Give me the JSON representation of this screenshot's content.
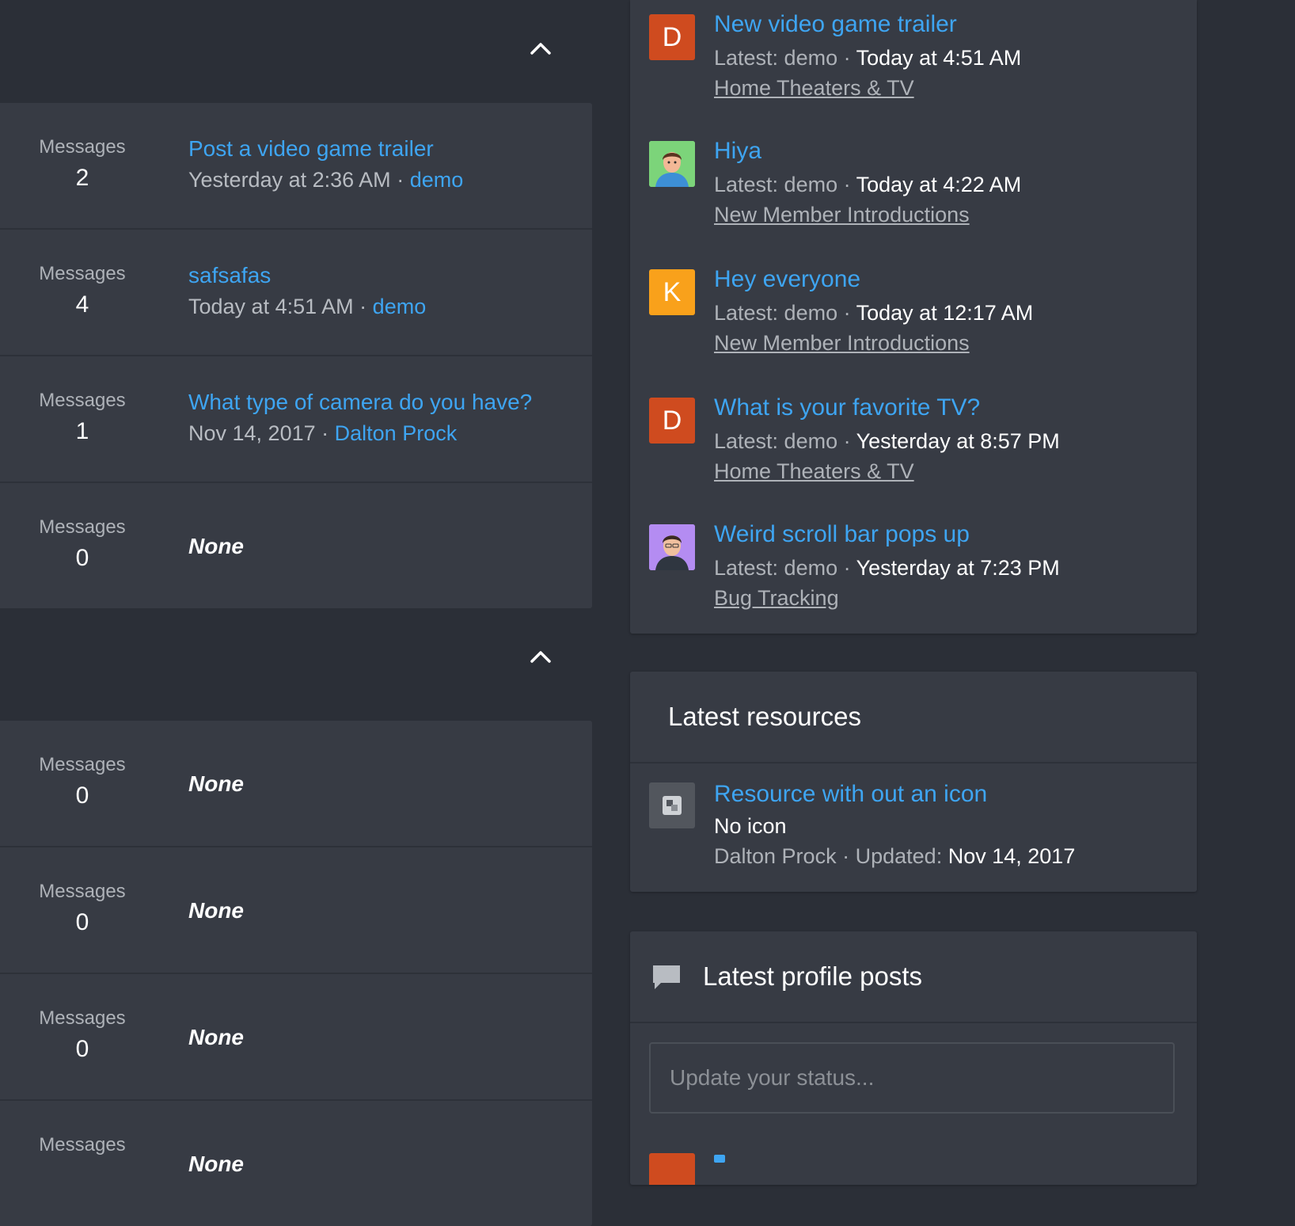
{
  "left": {
    "category1": {
      "nodes": [
        {
          "stats_label": "Messages",
          "count": "2",
          "title": "Post a video game trailer",
          "date": "Yesterday at 2:36 AM",
          "sep": "·",
          "user": "demo"
        },
        {
          "stats_label": "Messages",
          "count": "4",
          "title": "safsafas",
          "date": "Today at 4:51 AM",
          "sep": "·",
          "user": "demo"
        },
        {
          "stats_label": "Messages",
          "count": "1",
          "title": "What type of camera do you have?",
          "date": "Nov 14, 2017",
          "sep": "·",
          "user": "Dalton Prock"
        },
        {
          "stats_label": "Messages",
          "count": "0",
          "none": "None"
        }
      ]
    },
    "category2": {
      "nodes": [
        {
          "stats_label": "Messages",
          "count": "0",
          "none": "None"
        },
        {
          "stats_label": "Messages",
          "count": "0",
          "none": "None"
        },
        {
          "stats_label": "Messages",
          "count": "0",
          "none": "None"
        },
        {
          "stats_label": "Messages",
          "count": "",
          "none": "None"
        }
      ]
    }
  },
  "latest_threads": [
    {
      "avatar_letter": "D",
      "avatar_color": "#cf4b1f",
      "title": "New video game trailer",
      "latest_prefix": "Latest: demo",
      "sep": "·",
      "when": "Today at 4:51 AM",
      "forum": "Home Theaters & TV"
    },
    {
      "avatar_icon": "person-avatar-icon",
      "avatar_color": "#7cd47a",
      "title": "Hiya",
      "latest_prefix": "Latest: demo",
      "sep": "·",
      "when": "Today at 4:22 AM",
      "forum": "New Member Introductions"
    },
    {
      "avatar_letter": "K",
      "avatar_color": "#f9a11b",
      "title": "Hey everyone",
      "latest_prefix": "Latest: demo",
      "sep": "·",
      "when": "Today at 12:17 AM",
      "forum": "New Member Introductions"
    },
    {
      "avatar_letter": "D",
      "avatar_color": "#cf4b1f",
      "title": "What is your favorite TV?",
      "latest_prefix": "Latest: demo",
      "sep": "·",
      "when": "Yesterday at 8:57 PM",
      "forum": "Home Theaters & TV"
    },
    {
      "avatar_icon": "person-avatar-icon",
      "avatar_color": "#b48cf2",
      "title": "Weird scroll bar pops up",
      "latest_prefix": "Latest: demo",
      "sep": "·",
      "when": "Yesterday at 7:23 PM",
      "forum": "Bug Tracking"
    }
  ],
  "resources": {
    "heading": "Latest resources",
    "items": [
      {
        "title": "Resource with out an icon",
        "tag_line": "No icon",
        "author": "Dalton Prock",
        "sep": "·",
        "updated_label": "Updated:",
        "date": "Nov 14, 2017"
      }
    ]
  },
  "profile_posts": {
    "heading": "Latest profile posts",
    "placeholder": "Update your status..."
  },
  "colors": {
    "accent": "#3ea5f2",
    "panel": "#373b44",
    "page": "#2b2f37"
  }
}
